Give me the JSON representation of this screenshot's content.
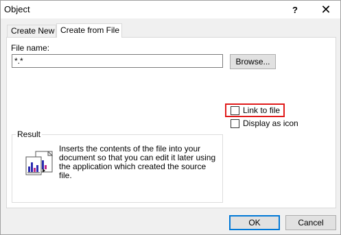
{
  "window": {
    "title": "Object",
    "help_glyph": "?",
    "close_glyph": "✕"
  },
  "tabs": [
    {
      "label": "Create New",
      "active": false
    },
    {
      "label": "Create from File",
      "active": true
    }
  ],
  "file": {
    "label": "File name:",
    "value": "*.*",
    "browse_label": "Browse..."
  },
  "options": {
    "link_label": "Link to file",
    "link_checked": false,
    "display_label": "Display as icon",
    "display_checked": false,
    "highlight_color": "#e01a1a"
  },
  "result": {
    "label": "Result",
    "text": "Inserts the contents of the file into your document so that you can edit it later using the application which created the source file.",
    "icon": "document-chart-icon"
  },
  "buttons": {
    "ok": "OK",
    "cancel": "Cancel"
  }
}
